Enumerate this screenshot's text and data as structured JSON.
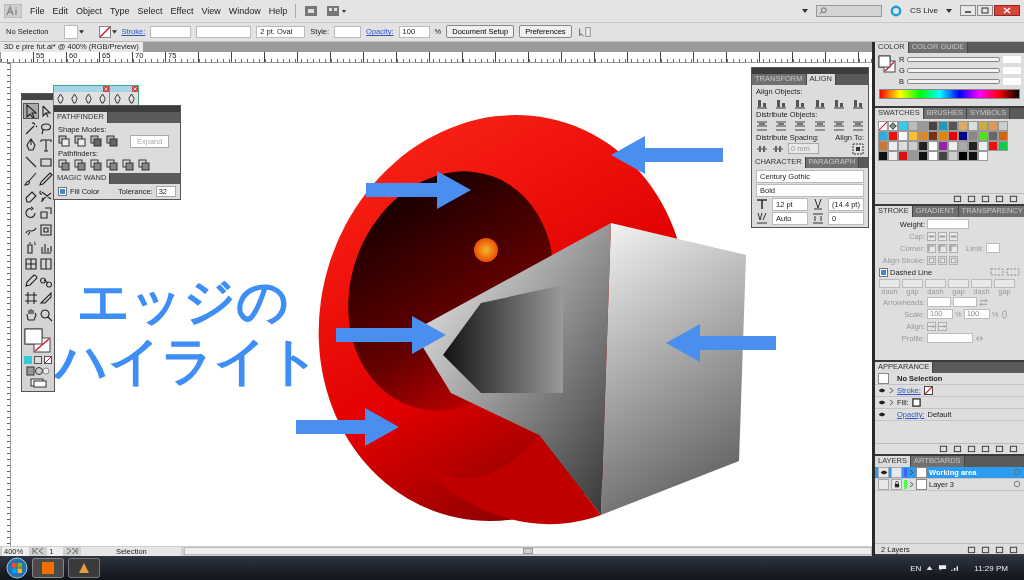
{
  "menu_bar": {
    "items": [
      "File",
      "Edit",
      "Object",
      "Type",
      "Select",
      "Effect",
      "View",
      "Window",
      "Help"
    ],
    "cs_live": "CS Live"
  },
  "control_bar": {
    "selection": "No Selection",
    "stroke_label": "Stroke:",
    "brush": "2 pt. Oval",
    "style_label": "Style:",
    "opacity_label": "Opacity:",
    "opacity": "100",
    "percent": "%",
    "buttons": [
      "Document Setup",
      "Preferences"
    ]
  },
  "document": {
    "tab_title": "3D e pire fut.ai* @ 400% (RGB/Preview)",
    "ruler_labels": [
      "55",
      "60",
      "65",
      "70",
      "75"
    ],
    "caption_lines": [
      "エッジの",
      "ハイライト"
    ]
  },
  "pathfinder": {
    "title": "PATHFINDER",
    "shape_modes": "Shape Modes:",
    "expand": "Expand",
    "expand_disabled": true,
    "pathfinders": "Pathfinders:"
  },
  "magic_wand": {
    "title": "MAGIC WAND",
    "fill_color": {
      "label": "Fill Color",
      "checked": true
    },
    "tolerance_label": "Tolerance:",
    "tolerance": "32"
  },
  "align_panel": {
    "tabs": [
      {
        "label": "TRANSFORM",
        "selected": false
      },
      {
        "label": "ALIGN",
        "selected": true
      }
    ],
    "align_objects": "Align Objects:",
    "distribute_objects": "Distribute Objects:",
    "distribute_spacing": "Distribute Spacing:",
    "spacing": "0 mm",
    "align_to": "Align To:"
  },
  "character_panel": {
    "tabs": [
      {
        "label": "CHARACTER",
        "selected": true
      },
      {
        "label": "PARAGRAPH",
        "selected": false
      }
    ],
    "font": "Century Gothic",
    "style": "Bold",
    "size": "12 pt",
    "leading": "(14.4 pt)",
    "kerning": "Auto",
    "tracking": "0"
  },
  "color_panel": {
    "tabs": [
      {
        "label": "COLOR",
        "selected": true
      },
      {
        "label": "COLOR GUIDE",
        "selected": false
      }
    ],
    "channels": [
      {
        "label": "R",
        "level": 0
      },
      {
        "label": "G",
        "level": 0
      },
      {
        "label": "B",
        "level": 0
      }
    ]
  },
  "swatches_panel": {
    "tabs": [
      {
        "label": "SWATCHES",
        "selected": true
      },
      {
        "label": "BRUSHES",
        "selected": false
      },
      {
        "label": "SYMBOLS",
        "selected": false
      }
    ],
    "swatches": [
      {
        "color": "#33ccee"
      },
      {
        "color": "#bbbbbb"
      },
      {
        "color": "#999999"
      },
      {
        "color": "#444444"
      },
      {
        "color": "#2299bb"
      },
      {
        "color": "#555555"
      },
      {
        "color": "#ddaa66"
      },
      {
        "color": "#dddddd"
      },
      {
        "color": "#ccaa44"
      },
      {
        "color": "#dd9955"
      },
      {
        "color": "#cccccc"
      },
      {
        "color": "#33aadd"
      },
      {
        "color": "#ee1111"
      },
      {
        "color": "#ffffff"
      },
      {
        "color": "#ffbb33"
      },
      {
        "color": "#dd8822"
      },
      {
        "color": "#773311"
      },
      {
        "color": "#dd8800"
      },
      {
        "color": "#ee0000"
      },
      {
        "color": "#000088"
      },
      {
        "color": "#888888"
      },
      {
        "color": "#55dd22"
      },
      {
        "color": "#666666"
      },
      {
        "color": "#cc6611"
      },
      {
        "color": "#cc7733"
      },
      {
        "color": "#eeeeee"
      },
      {
        "color": "#dddddd"
      },
      {
        "color": "#cccccc"
      },
      {
        "color": "#222222"
      },
      {
        "color": "#ffffff"
      },
      {
        "color": "#9922aa"
      },
      {
        "color": "#eeeeee"
      },
      {
        "color": "#aaaaaa"
      },
      {
        "color": "#222222"
      },
      {
        "color": "#eeeeee"
      },
      {
        "color": "#ee1111"
      },
      {
        "color": "#11cc44"
      },
      {
        "color": "#111111"
      },
      {
        "color": "#eeeeee"
      },
      {
        "color": "#dd1111"
      },
      {
        "color": "#999999"
      },
      {
        "color": "#111111"
      },
      {
        "color": "#ffffff"
      },
      {
        "color": "#444444"
      },
      {
        "color": "#cccccc"
      },
      {
        "color": "#000000"
      },
      {
        "color": "#111111"
      },
      {
        "color": "#ffffff"
      }
    ]
  },
  "stroke_panel": {
    "tabs": [
      {
        "label": "STROKE",
        "selected": true
      },
      {
        "label": "GRADIENT",
        "selected": false
      },
      {
        "label": "TRANSPARENCY",
        "selected": false
      }
    ],
    "weight": "Weight:",
    "cap": "Cap:",
    "corner": "Corner:",
    "limit": "Limit:",
    "align_stroke": "Align Stroke:",
    "dashed_line": {
      "label": "Dashed Line",
      "checked": true
    },
    "dash_labels": [
      "dash",
      "gap",
      "dash",
      "gap",
      "dash",
      "gap"
    ],
    "arrowheads": "Arrowheads:",
    "scale": "Scale:",
    "scale_values": [
      "100",
      "100"
    ],
    "percent_signs": [
      "%",
      "%"
    ],
    "align": "Align:",
    "profile": "Profile:"
  },
  "appearance_panel": {
    "title": "APPEARANCE",
    "header": "No Selection",
    "rows": [
      {
        "kind": "stroke",
        "label": "Stroke:"
      },
      {
        "kind": "fill",
        "label": "Fill:"
      },
      {
        "kind": "opacity",
        "label": "Opacity:",
        "value": "Default"
      }
    ]
  },
  "layers_panel": {
    "tabs": [
      {
        "label": "LAYERS",
        "selected": true
      },
      {
        "label": "ARTBOARDS",
        "selected": false
      }
    ],
    "layers": [
      {
        "name": "Working area",
        "selected": true,
        "visible": true,
        "locked": false,
        "color": "#4a5cff"
      },
      {
        "name": "Layer 3",
        "selected": false,
        "visible": false,
        "locked": true,
        "color": "#4cff4c"
      }
    ],
    "count": "2 Layers"
  },
  "status_bar": {
    "zoom": "400%",
    "artboard": "1",
    "tool": "Selection"
  },
  "taskbar": {
    "language": "EN",
    "time": "11:29 PM"
  }
}
